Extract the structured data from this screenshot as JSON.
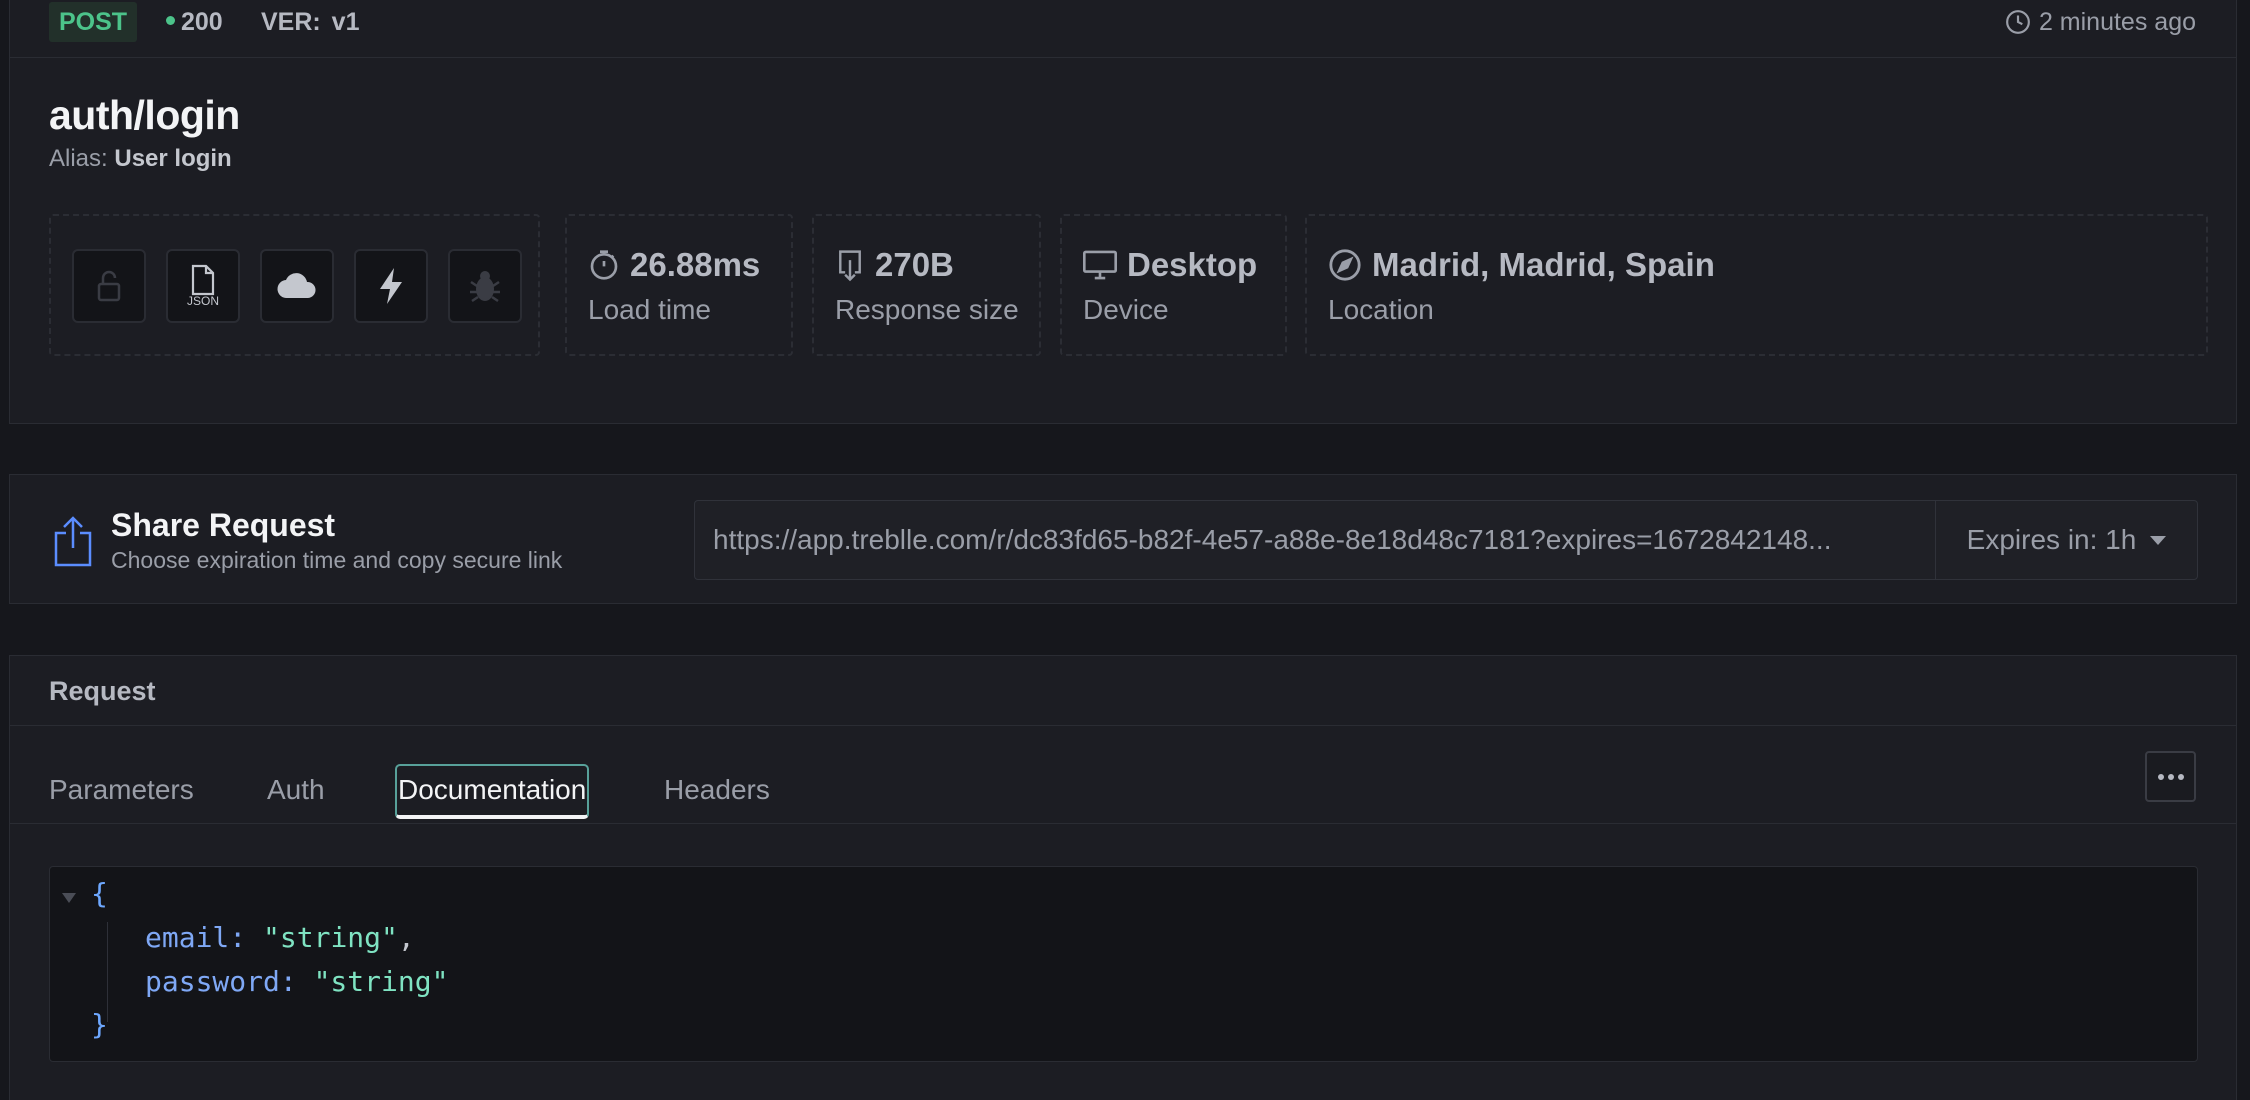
{
  "top_bar": {
    "method": "POST",
    "status_code": "200",
    "version": "VER: v1",
    "time_ago": "2 minutes ago"
  },
  "endpoint": {
    "title": "auth/login",
    "alias_label": "Alias:",
    "alias_value": "User login"
  },
  "feature_icons": [
    {
      "name": "lock-icon",
      "enabled": false
    },
    {
      "name": "json-file-icon",
      "enabled": true,
      "text": "JSON"
    },
    {
      "name": "cloud-icon",
      "enabled": true
    },
    {
      "name": "lightning-icon",
      "enabled": true
    },
    {
      "name": "bug-icon",
      "enabled": false
    }
  ],
  "metrics": {
    "load_time": {
      "value": "26.88ms",
      "label": "Load time",
      "icon": "stopwatch-icon"
    },
    "response_size": {
      "value": "270B",
      "label": "Response size",
      "icon": "download-icon"
    },
    "device": {
      "value": "Desktop",
      "label": "Device",
      "icon": "monitor-icon"
    },
    "location": {
      "value": "Madrid, Madrid, Spain",
      "label": "Location",
      "icon": "compass-icon"
    }
  },
  "share": {
    "title": "Share Request",
    "subtitle": "Choose expiration time and copy secure link",
    "url": "https://app.treblle.com/r/dc83fd65-b82f-4e57-a88e-8e18d48c7181?expires=1672842148...",
    "expires_label": "Expires in: 1h"
  },
  "request": {
    "heading": "Request",
    "tabs": [
      {
        "label": "Parameters",
        "active": false
      },
      {
        "label": "Auth",
        "active": false
      },
      {
        "label": "Documentation",
        "active": true
      },
      {
        "label": "Headers",
        "active": false
      }
    ],
    "code": {
      "open_brace": "{",
      "lines": [
        {
          "key": "email",
          "colon": ": ",
          "value": "\"string\"",
          "trail": ","
        },
        {
          "key": "password",
          "colon": ": ",
          "value": "\"string\"",
          "trail": ""
        }
      ],
      "close_brace": "}"
    }
  },
  "colors": {
    "background": "#16171c",
    "panel": "#1c1d23",
    "accent_green": "#4cc38a",
    "active_tab_border": "#58a19a",
    "share_icon": "#5b8dff"
  }
}
